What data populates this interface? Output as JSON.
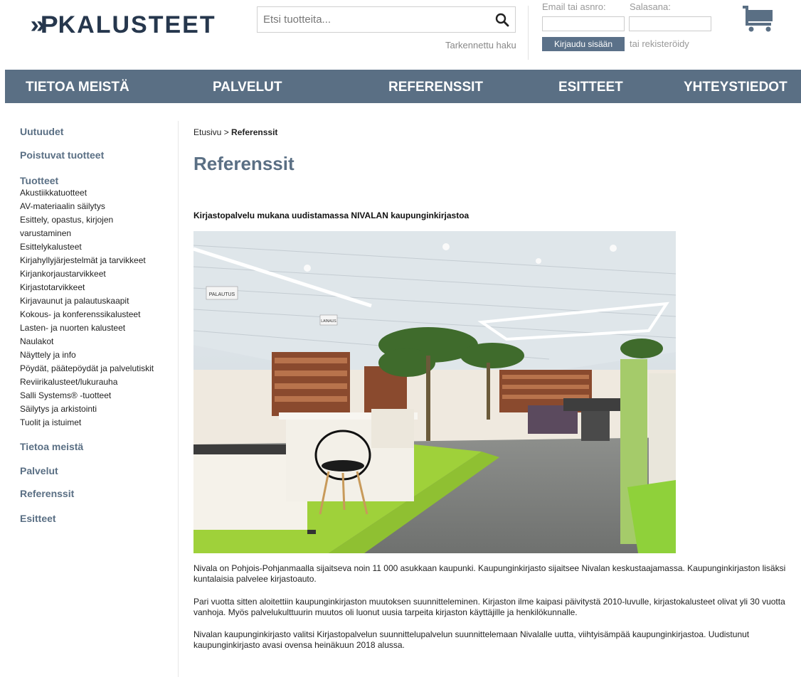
{
  "header": {
    "logo_mark": "»P",
    "logo_text": "KALUSTEET",
    "search": {
      "placeholder": "Etsi tuotteita...",
      "advanced_label": "Tarkennettu haku"
    },
    "login": {
      "email_label": "Email tai asnro:",
      "password_label": "Salasana:",
      "login_button": "Kirjaudu sisään",
      "register_label": "tai rekisteröidy"
    },
    "cart_icon": "shopping-cart-icon"
  },
  "nav": {
    "items": [
      {
        "label": "TIETOA MEISTÄ"
      },
      {
        "label": "PALVELUT"
      },
      {
        "label": "REFERENSSIT"
      },
      {
        "label": "ESITTEET"
      },
      {
        "label": "YHTEYSTIEDOT"
      }
    ]
  },
  "sidebar": {
    "uutuudet": "Uutuudet",
    "poistuvat": "Poistuvat tuotteet",
    "tuotteet": "Tuotteet",
    "products": [
      "Akustiikkatuotteet",
      "AV-materiaalin säilytys",
      "Esittely, opastus, kirjojen",
      "varustaminen",
      "Esittelykalusteet",
      "Kirjahyllyjärjestelmät ja tarvikkeet",
      "Kirjankorjaustarvikkeet",
      "Kirjastotarvikkeet",
      "Kirjavaunut ja palautuskaapit",
      "Kokous- ja konferenssikalusteet",
      "Lasten- ja nuorten kalusteet",
      "Naulakot",
      "Näyttely ja info",
      "Pöydät, päätepöydät ja palvelutiskit",
      "Reviirikalusteet/lukurauha",
      "Salli Systems® -tuotteet",
      "Säilytys ja arkistointi",
      "Tuolit ja istuimet"
    ],
    "tietoa": "Tietoa meistä",
    "palvelut": "Palvelut",
    "referenssit": "Referenssit",
    "esitteet": "Esitteet"
  },
  "main": {
    "breadcrumb_home": "Etusivu",
    "breadcrumb_sep": " > ",
    "breadcrumb_current": "Referenssit",
    "title": "Referenssit",
    "article_title": "Kirjastopalvelu mukana uudistamassa NIVALAN kaupunginkirjastoa",
    "sign_palautus": "PALAUTUS",
    "sign_lainaus": "LAINAUS",
    "paragraphs": [
      "Nivala on Pohjois-Pohjanmaalla sijaitseva noin 11 000 asukkaan kaupunki. Kaupunginkirjasto sijaitsee Nivalan keskustaajamassa. Kaupunginkirjaston lisäksi kuntalaisia palvelee kirjastoauto.",
      "Pari vuotta sitten aloitettiin kaupunginkirjaston muutoksen suunnitteleminen. Kirjaston ilme kaipasi päivitystä 2010-luvulle, kirjastokalusteet olivat yli 30 vuotta vanhoja. Myös palvelukulttuurin muutos oli luonut uusia tarpeita kirjaston käyttäjille ja henkilökunnalle.",
      "Nivalan kaupunginkirjasto valitsi Kirjastopalvelun suunnittelupalvelun suunnittelemaan Nivalalle uutta, viihtyisämpää kaupunginkirjastoa. Uudistunut kaupunginkirjasto avasi ovensa heinäkuun 2018 alussa."
    ]
  },
  "colors": {
    "brand_dark": "#26374d",
    "nav_bg": "#5a6f84",
    "accent_green": "#9fd13a"
  }
}
